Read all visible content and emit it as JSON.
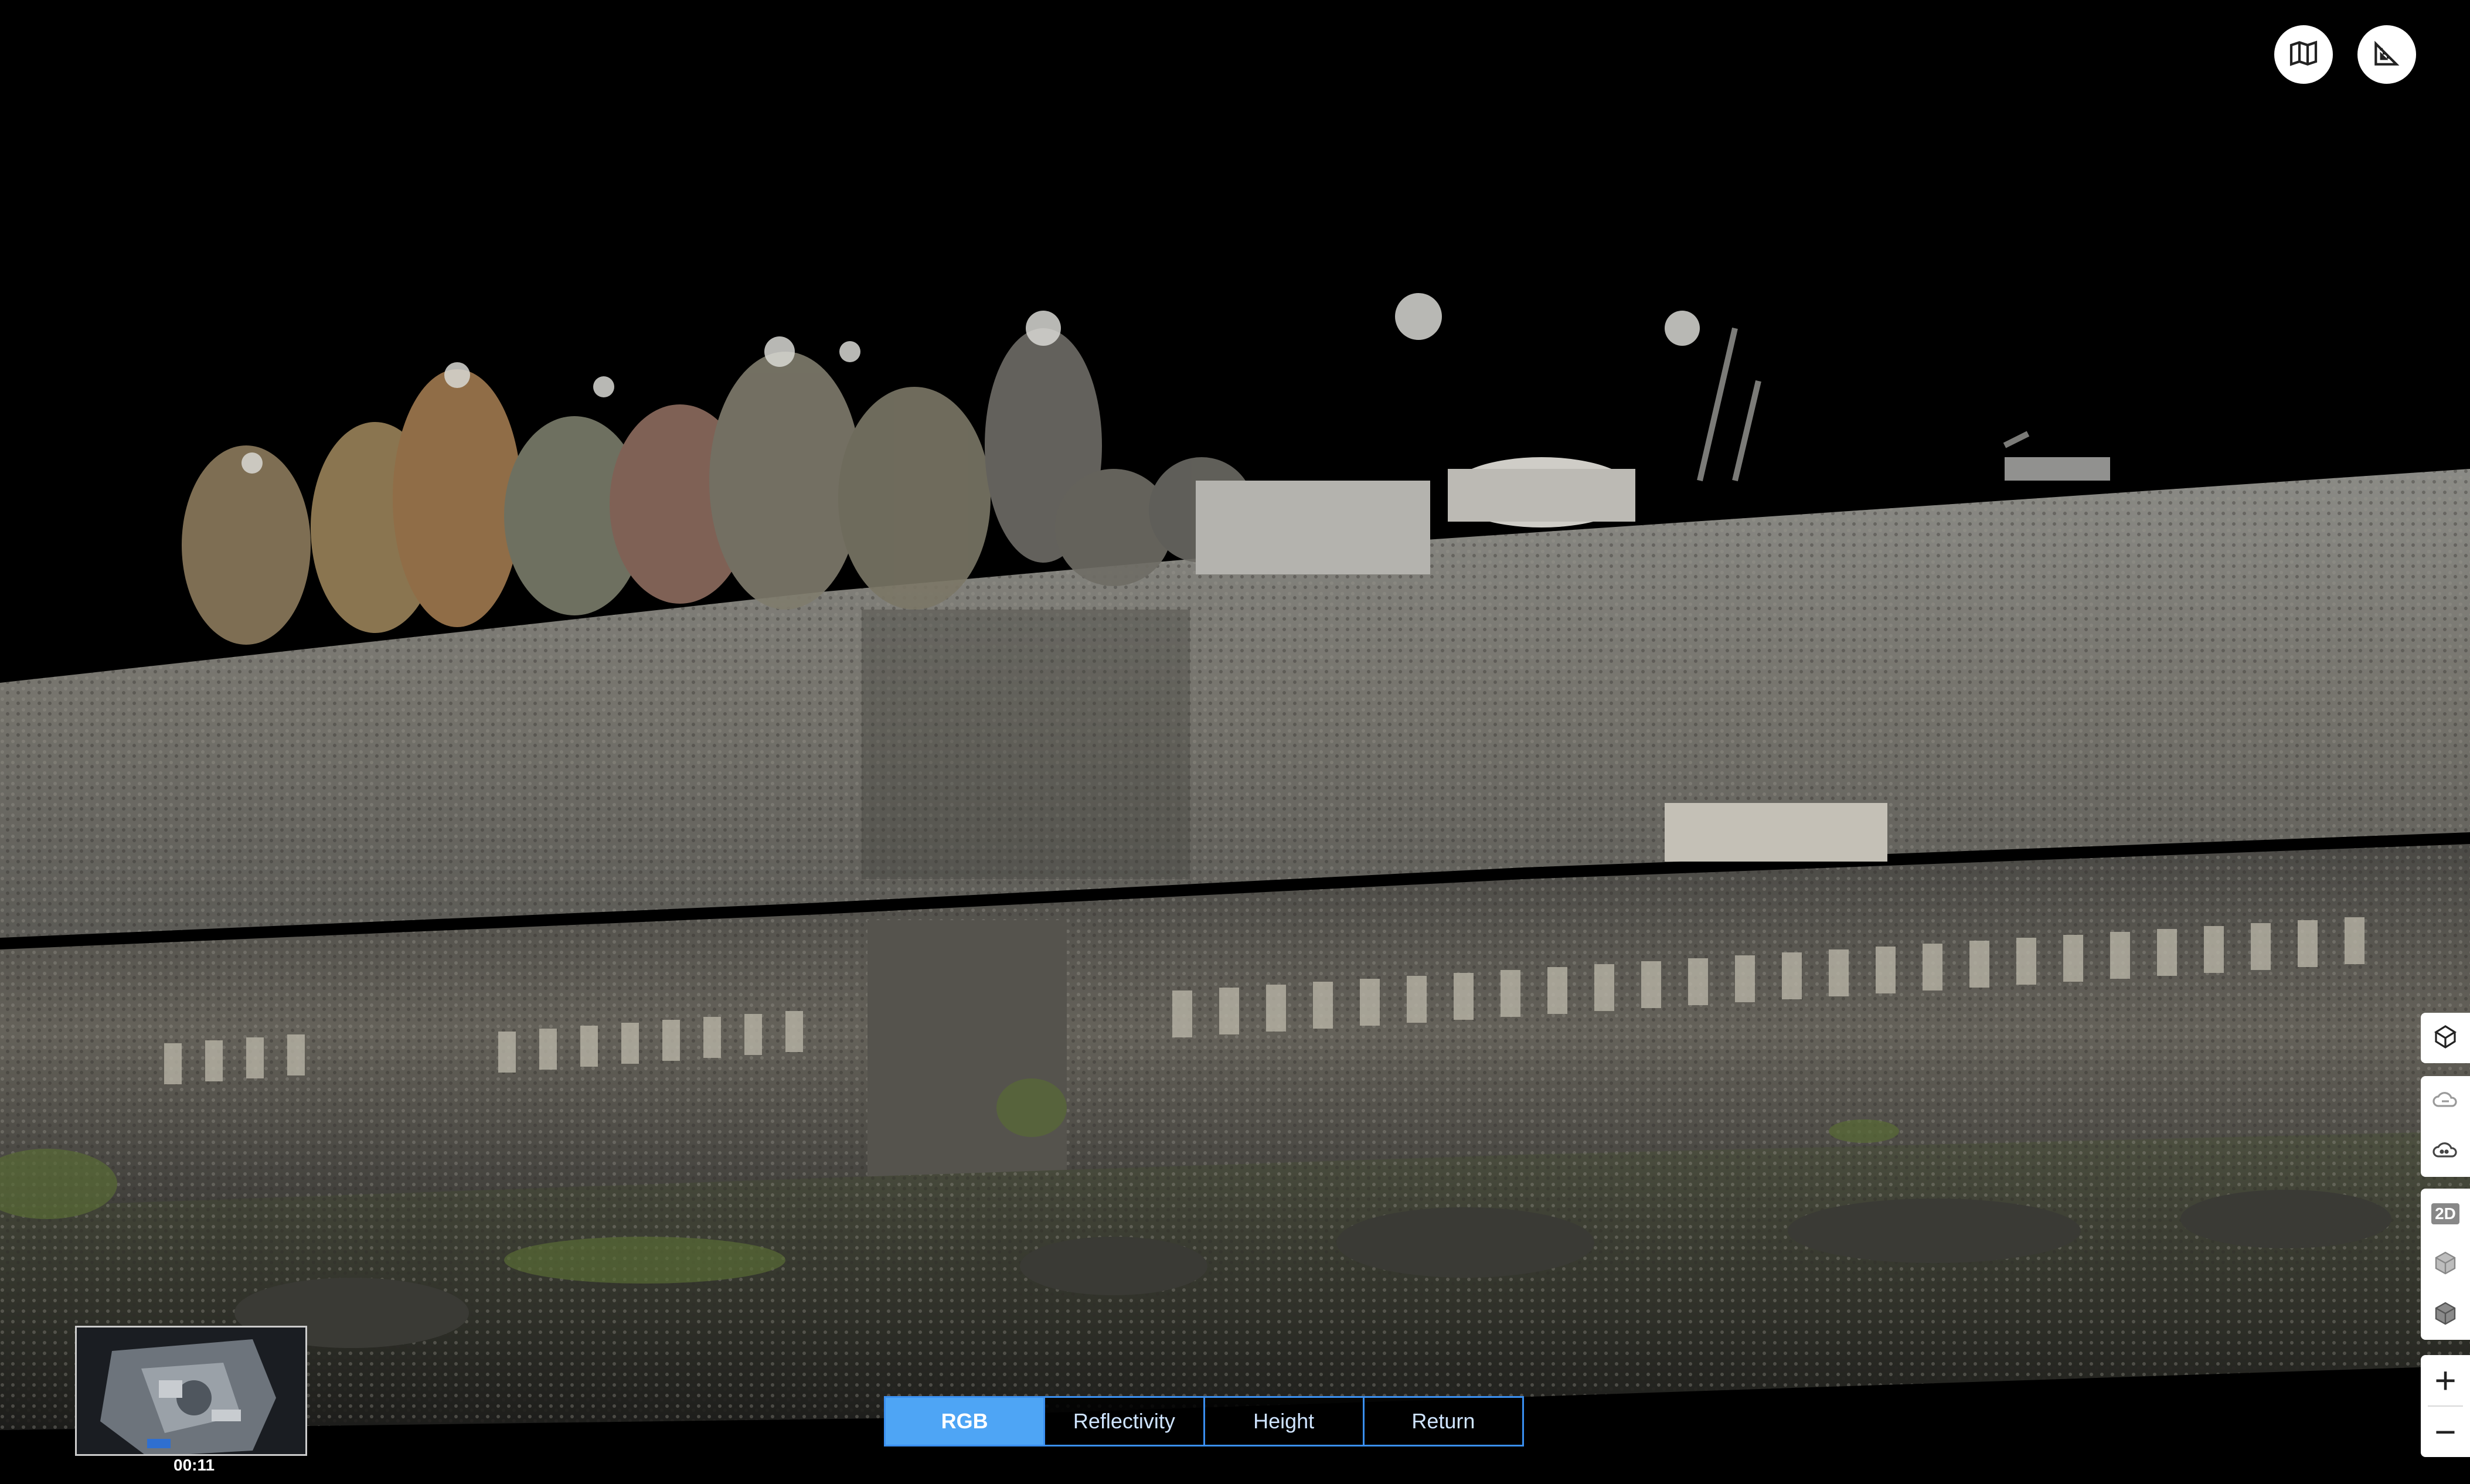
{
  "viewer": {
    "background_color": "#000000",
    "accent_color": "#3a8ff0",
    "active_segment_color": "#4ea5f5"
  },
  "top_controls": [
    {
      "icon": "map-icon"
    },
    {
      "icon": "measure-icon"
    }
  ],
  "right_toolbar": {
    "view_group": [
      {
        "icon": "point-cloud-view-icon"
      },
      {
        "icon": "cloud-mode-icon"
      },
      {
        "icon": "cloud-texture-icon"
      }
    ],
    "projection_group": [
      {
        "label": "2D",
        "icon": "2d-view-icon"
      },
      {
        "icon": "cube-icon"
      },
      {
        "icon": "cube-solid-icon"
      }
    ],
    "zoom": {
      "in_label": "+",
      "out_label": "−"
    }
  },
  "color_modes": {
    "selected": "RGB",
    "options": [
      "RGB",
      "Reflectivity",
      "Height",
      "Return"
    ]
  },
  "minimap": {
    "time": "00:11"
  }
}
